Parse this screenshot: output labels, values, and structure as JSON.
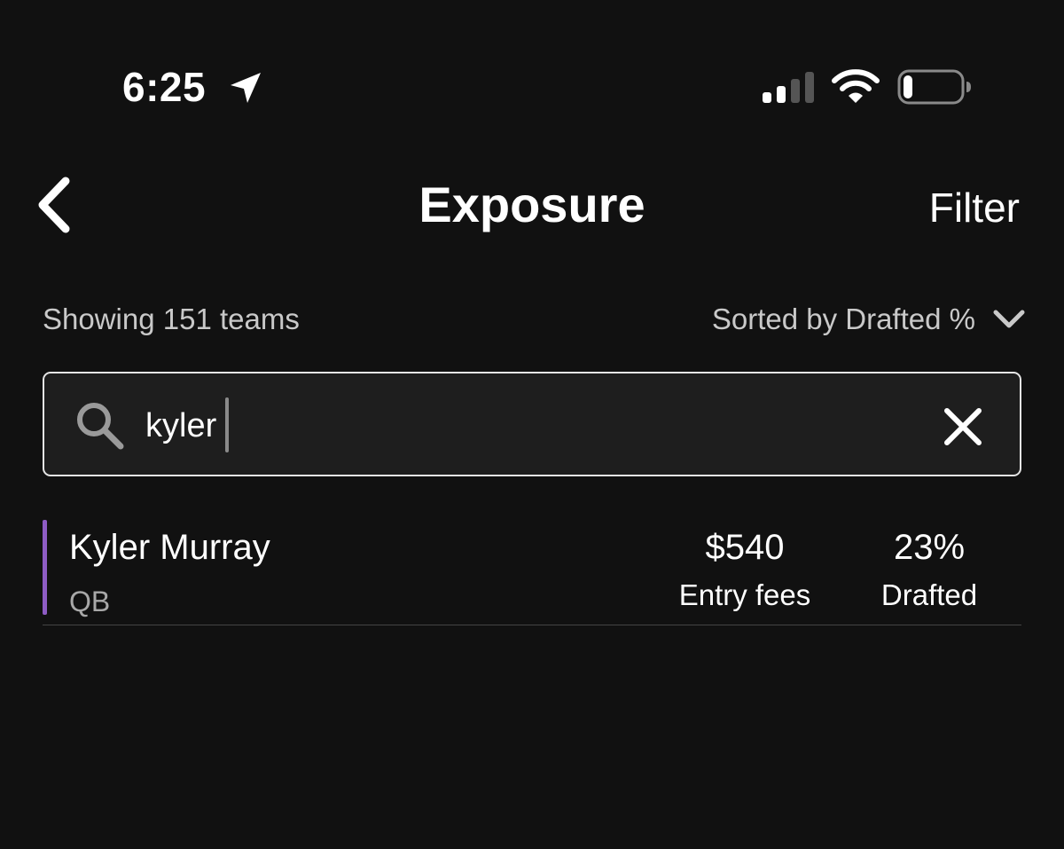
{
  "status_bar": {
    "time": "6:25",
    "location_icon": "location-arrow-icon",
    "signal_icon": "cellular-signal-icon",
    "wifi_icon": "wifi-icon",
    "battery_icon": "battery-low-icon",
    "signal_bars_active": 2,
    "signal_bars_total": 4,
    "battery_level": 0.15
  },
  "header": {
    "back_icon": "chevron-left-icon",
    "title": "Exposure",
    "filter_label": "Filter"
  },
  "summary": {
    "team_count_text": "Showing 151 teams",
    "sort_label": "Sorted by Drafted %",
    "sort_icon": "chevron-down-icon"
  },
  "search": {
    "icon": "search-icon",
    "value": "kyler",
    "clear_icon": "close-icon"
  },
  "results": [
    {
      "name": "Kyler Murray",
      "position": "QB",
      "position_color": "#8e5cc4",
      "entry_fees": "$540",
      "entry_fees_label": "Entry fees",
      "drafted": "23%",
      "drafted_label": "Drafted"
    }
  ],
  "colors": {
    "background": "#111111",
    "text_primary": "#ffffff",
    "text_secondary": "#c9c9c9",
    "qb_accent": "#8e5cc4"
  }
}
